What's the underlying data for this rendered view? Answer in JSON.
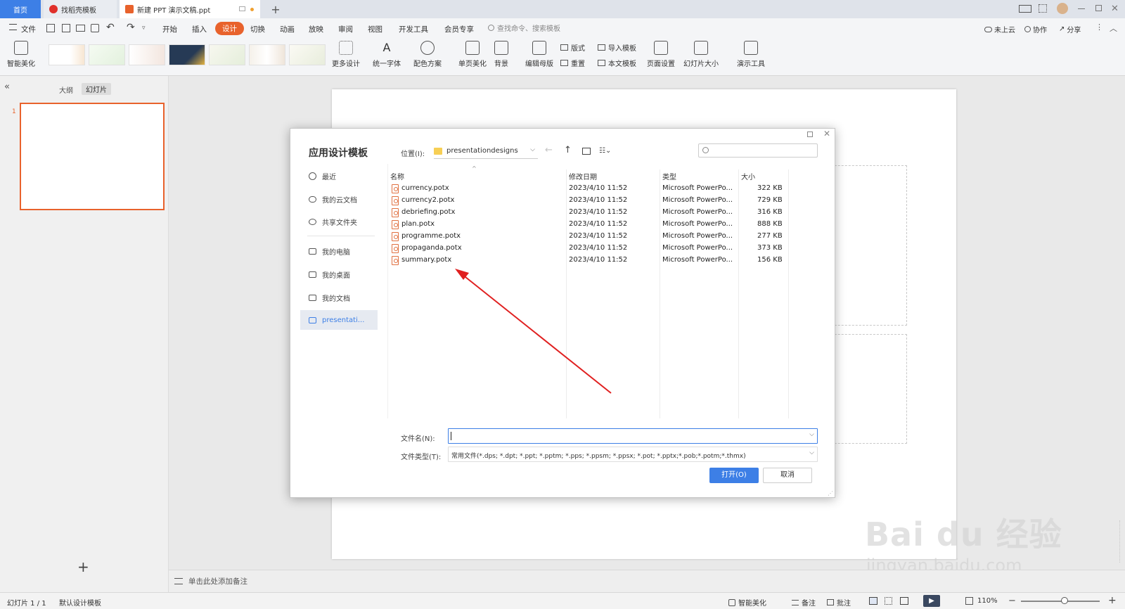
{
  "tabs": [
    {
      "label": "首页"
    },
    {
      "label": "找稻壳模板"
    },
    {
      "label": "新建 PPT 演示文稿.ppt"
    }
  ],
  "tab_add": "+",
  "menu": {
    "file": "文件",
    "items": [
      "开始",
      "插入",
      "设计",
      "切换",
      "动画",
      "放映",
      "审阅",
      "视图",
      "开发工具",
      "会员专享"
    ],
    "active": "设计",
    "search_placeholder": "查找命令、搜索模板",
    "right": [
      "未上云",
      "协作",
      "分享"
    ]
  },
  "ribbon": {
    "smart_beautify": "智能美化",
    "more_design": "更多设计",
    "unify_font": "统一字体",
    "color_scheme": "配色方案",
    "single_page_beautify": "单页美化",
    "background": "背景",
    "edit_master": "编辑母版",
    "layout": "版式",
    "reset": "重置",
    "import_template": "导入模板",
    "this_template": "本文模板",
    "page_setup": "页面设置",
    "slide_size": "幻灯片大小",
    "present_tools": "演示工具"
  },
  "left_panel": {
    "collapse": "«",
    "tab_outline": "大纲",
    "tab_slides": "幻灯片",
    "slide_number": "1",
    "add": "+"
  },
  "notes_placeholder": "单击此处添加备注",
  "status": {
    "slide_info": "幻灯片 1 / 1",
    "design_template": "默认设计模板",
    "smart_beautify": "智能美化",
    "notes": "备注",
    "comments": "批注",
    "zoom": "110%"
  },
  "dialog": {
    "title": "应用设计模板",
    "location_label": "位置(I):",
    "location_value": "presentationdesigns",
    "nav": [
      "最近",
      "我的云文档",
      "共享文件夹",
      "我的电脑",
      "我的桌面",
      "我的文档",
      "presentati..."
    ],
    "columns": [
      "名称",
      "修改日期",
      "类型",
      "大小"
    ],
    "files": [
      {
        "name": "currency.potx",
        "date": "2023/4/10 11:52",
        "type": "Microsoft PowerPo...",
        "size": "322 KB"
      },
      {
        "name": "currency2.potx",
        "date": "2023/4/10 11:52",
        "type": "Microsoft PowerPo...",
        "size": "729 KB"
      },
      {
        "name": "debriefing.potx",
        "date": "2023/4/10 11:52",
        "type": "Microsoft PowerPo...",
        "size": "316 KB"
      },
      {
        "name": "plan.potx",
        "date": "2023/4/10 11:52",
        "type": "Microsoft PowerPo...",
        "size": "888 KB"
      },
      {
        "name": "programme.potx",
        "date": "2023/4/10 11:52",
        "type": "Microsoft PowerPo...",
        "size": "277 KB"
      },
      {
        "name": "propaganda.potx",
        "date": "2023/4/10 11:52",
        "type": "Microsoft PowerPo...",
        "size": "373 KB"
      },
      {
        "name": "summary.potx",
        "date": "2023/4/10 11:52",
        "type": "Microsoft PowerPo...",
        "size": "156 KB"
      }
    ],
    "filename_label": "文件名(N):",
    "filename_value": "",
    "filetype_label": "文件类型(T):",
    "filetype_value": "常用文件(*.dps; *.dpt; *.ppt; *.pptm; *.pps; *.ppsm; *.ppsx; *.pot; *.pptx;*.pob;*.potm;*.thmx)",
    "open_button": "打开(O)",
    "cancel_button": "取消"
  },
  "watermark": {
    "brand": "Bai du 经验",
    "url": "jingyan.baidu.com"
  },
  "colors": {
    "accent_orange": "#e8622c",
    "primary_blue": "#3d7fe6",
    "annotation_red": "#e02020"
  }
}
